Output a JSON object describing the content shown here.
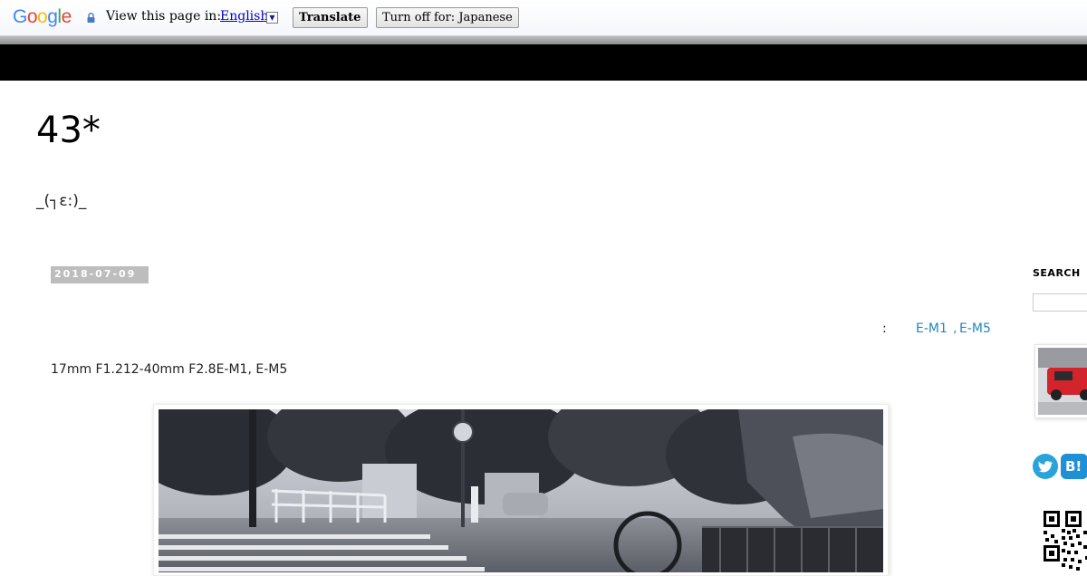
{
  "translate_bar": {
    "logo_letters": [
      "G",
      "o",
      "o",
      "g",
      "l",
      "e"
    ],
    "logo_colors": [
      "#4285f4",
      "#ea4335",
      "#fbbc05",
      "#4285f4",
      "#34a853",
      "#ea4335"
    ],
    "view_label": "View this page in:",
    "language": "English",
    "dropdown_glyph": "▼",
    "translate_button": "Translate",
    "turn_off_button": "Turn off for: Japanese"
  },
  "blog": {
    "title": "43*",
    "description": "_(┐ε:)_"
  },
  "post": {
    "date": "2018-07-09",
    "labels_colon": ":",
    "labels": [
      "E-M1",
      "E-M5"
    ],
    "labels_separator": ",",
    "body_text": "17mm F1.212-40mm F2.8E-M1, E-M5"
  },
  "sidebar": {
    "search_title": "SEARCH",
    "search_placeholder": "",
    "twitter_glyph": "🐦",
    "hatena_label": "B!"
  },
  "colors": {
    "link": "#2288bb",
    "date_badge_bg": "#bdbdbd",
    "header_band": "#000000"
  }
}
